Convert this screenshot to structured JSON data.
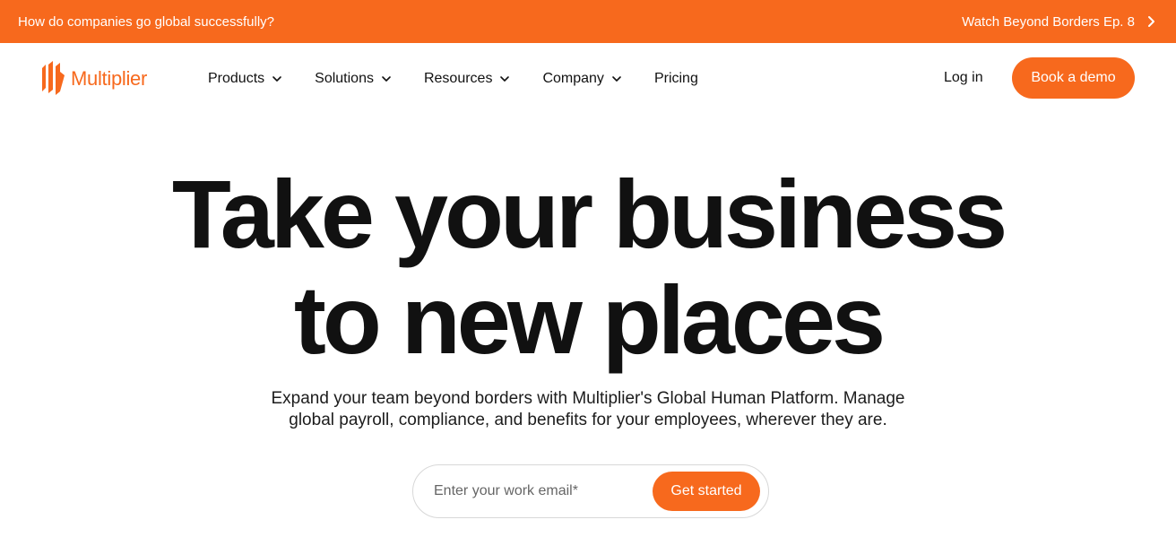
{
  "colors": {
    "brand_orange": "#f7691d",
    "text_dark": "#111111",
    "white": "#ffffff"
  },
  "announcement": {
    "left_text": "How do companies go global successfully?",
    "right_text": "Watch Beyond Borders Ep. 8",
    "right_icon": "chevron-right-icon"
  },
  "header": {
    "logo_text": "Multiplier",
    "logo_icon": "multiplier-logo-icon",
    "nav": [
      {
        "label": "Products",
        "has_dropdown": true
      },
      {
        "label": "Solutions",
        "has_dropdown": true
      },
      {
        "label": "Resources",
        "has_dropdown": true
      },
      {
        "label": "Company",
        "has_dropdown": true
      },
      {
        "label": "Pricing",
        "has_dropdown": false
      }
    ],
    "login_label": "Log in",
    "demo_label": "Book a demo"
  },
  "hero": {
    "title_line1": "Take your business",
    "title_line2": "to new places",
    "subtitle_line1": "Expand your team beyond borders with Multiplier's Global Human Platform. Manage",
    "subtitle_line2": "global payroll, compliance, and benefits for your employees, wherever they are."
  },
  "signup": {
    "email_placeholder": "Enter your work email*",
    "email_value": "",
    "submit_label": "Get started"
  }
}
